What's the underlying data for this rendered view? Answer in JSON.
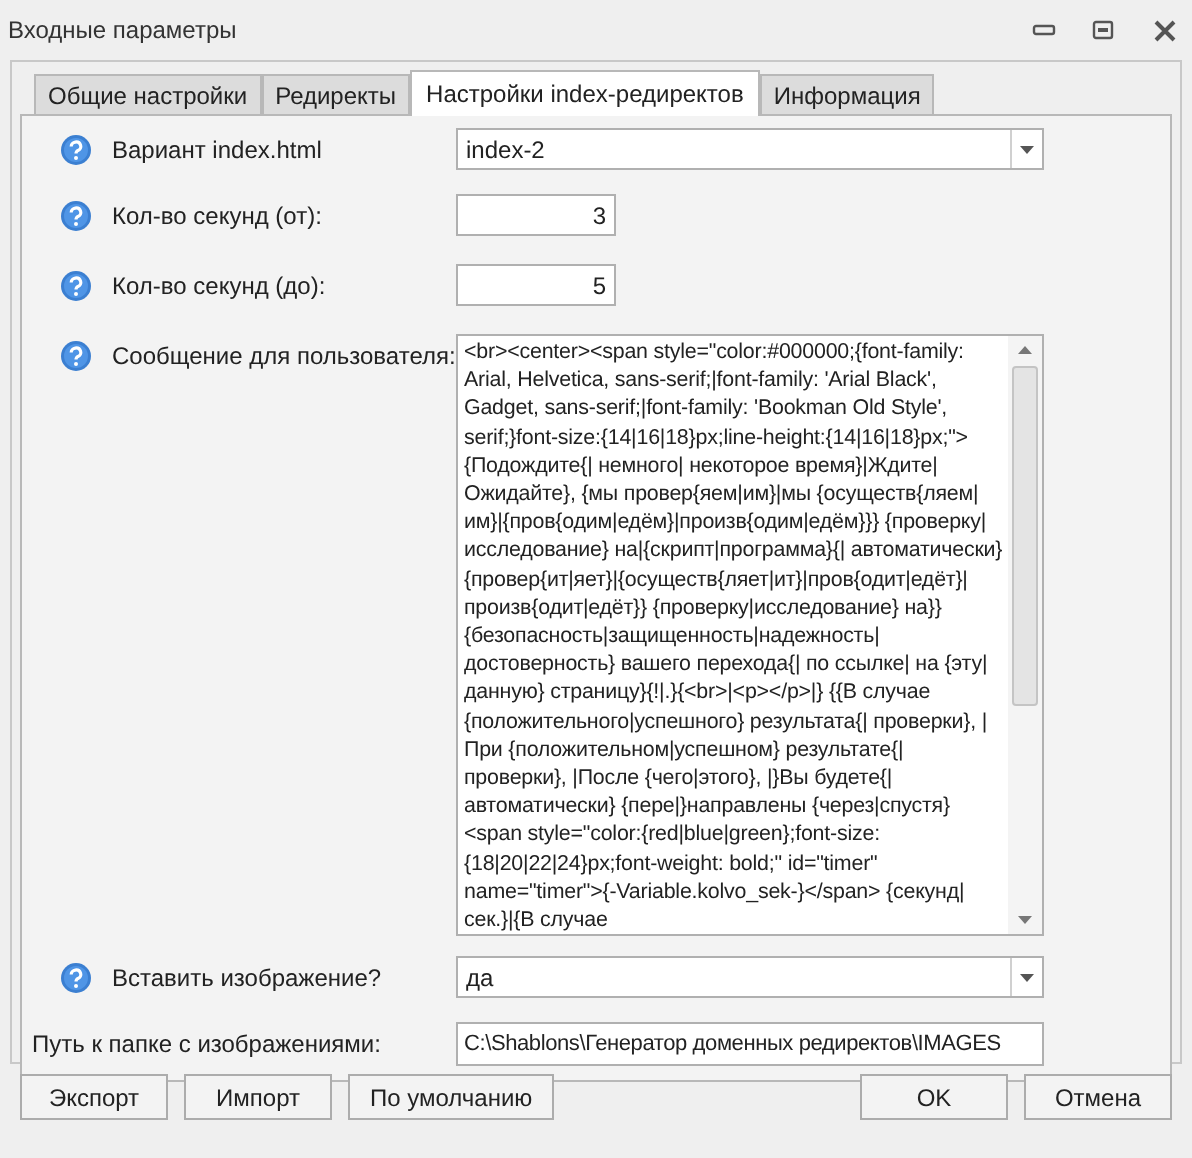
{
  "window": {
    "title": "Входные параметры"
  },
  "tabs": [
    {
      "label": "Общие настройки",
      "selected": false
    },
    {
      "label": "Редиректы",
      "selected": false
    },
    {
      "label": "Настройки index-редиректов",
      "selected": true
    },
    {
      "label": "Информация",
      "selected": false
    }
  ],
  "fields": [
    {
      "kind": "dropdown",
      "label": "Вариант index.html",
      "help": true,
      "value": "index-2"
    },
    {
      "kind": "number",
      "label": "Кол-во секунд (от):",
      "help": true,
      "value": "3"
    },
    {
      "kind": "number",
      "label": "Кол-во секунд (до):",
      "help": true,
      "value": "5"
    },
    {
      "kind": "textarea",
      "label": "Сообщение для пользователя:",
      "help": true,
      "value": "<br><center><span style=\"color:#000000;{font-family: Arial, Helvetica, sans-serif;|font-family: 'Arial Black', Gadget, sans-serif;|font-family: 'Bookman Old Style', serif;}font-size:{14|16|18}px;line-height:{14|16|18}px;\">{Подождите{| немного| некоторое время}|Ждите|Ожидайте}, {мы провер{яем|им}|мы {осуществ{ляем|им}|{пров{одим|едём}|произв{одим|едём}}} {проверку|исследование} на|{скрипт|программа}{| автоматически} {провер{ит|яет}|{осуществ{ляет|ит}|пров{одит|едёт}|произв{одит|едёт}} {проверку|исследование} на}} {безопасность|защищенность|надежность|достоверность} вашего перехода{| по ссылке| на {эту|данную} страницу}{!|.}{<br>|<p></p>|} {{В случае {положительного|успешного} результата{| проверки}, |При {положительном|успешном} результате{| проверки}, |После {чего|этого}, |}Вы будете{| автоматически} {пере|}направлены {через|спустя} <span style=\"color:{red|blue|green};font-size:{18|20|22|24}px;font-weight: bold;\" id=\"timer\" name=\"timer\">{-Variable.kolvo_sek-}</span> {секунд|сек.}|{В случае"
    },
    {
      "kind": "dropdown",
      "label": "Вставить изображение?",
      "help": true,
      "value": "да"
    },
    {
      "kind": "text",
      "label": "Путь к папке с изображениями:",
      "help": false,
      "value": "C:\\Shablons\\Генератор доменных редиректов\\IMAGES"
    }
  ],
  "buttons_left": [
    "Экспорт",
    "Импорт",
    "По умолчанию"
  ],
  "buttons_right": [
    "OK",
    "Отмена"
  ]
}
